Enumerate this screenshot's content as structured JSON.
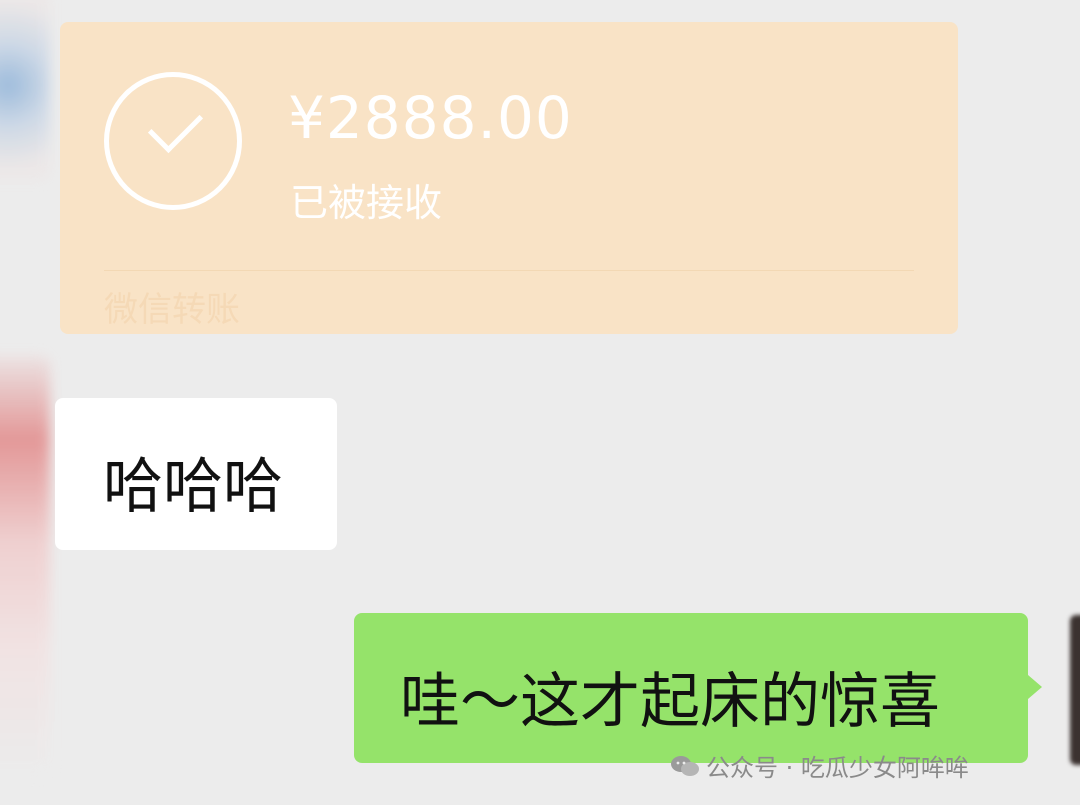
{
  "transfer": {
    "amount": "¥2888.00",
    "status": "已被接收",
    "service_label": "微信转账",
    "card_color": "#f9e3c6"
  },
  "messages": {
    "incoming_text": "哈哈哈",
    "outgoing_text": "哇～这才起床的惊喜",
    "outgoing_color": "#95e36a"
  },
  "watermark": {
    "text": "公众号 · 吃瓜少女阿哞哞",
    "icon": "wechat-icon"
  }
}
